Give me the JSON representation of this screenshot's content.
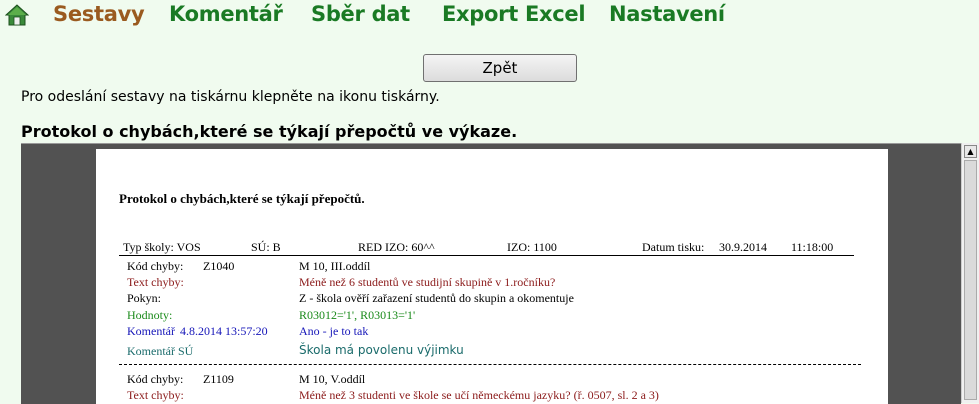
{
  "nav": {
    "home_icon": "home-icon",
    "items": [
      {
        "label": "Sestavy",
        "active": true
      },
      {
        "label": "Komentář",
        "active": false
      },
      {
        "label": "Sběr dat",
        "active": false
      },
      {
        "label": "Export Excel",
        "active": false
      },
      {
        "label": "Nastavení",
        "active": false
      }
    ]
  },
  "back_button": "Zpět",
  "instruction": "Pro odeslání sestavy na tiskárnu klepněte na ikonu tiskárny.",
  "heading": "Protokol o chybách,které se týkají přepočtů ve výkaze.",
  "report": {
    "title": "Protokol o chybách,které se týkají přepočtů.",
    "header": {
      "typ_skoly": "Typ školy: VOS",
      "su": "SÚ: B",
      "red_izo": "RED  IZO: 60^^",
      "izo": "IZO: 1100",
      "datum_label": "Datum tisku:",
      "datum": "30.9.2014",
      "time": "11:18:00"
    },
    "errors": [
      {
        "kod_label": "Kód chyby:",
        "kod": "Z1040",
        "section": "M 10, III.oddíl",
        "text_label": "Text chyby:",
        "text": "Méně než 6 studentů ve studijní skupině v 1.ročníku?",
        "pokyn_label": "Pokyn:",
        "pokyn": "Z - škola ověří zařazení studentů do skupin a okomentuje",
        "hodnoty_label": "Hodnoty:",
        "hodnoty": "R03012='1', R03013='1'",
        "komentar_label": "Komentář",
        "komentar_date": "4.8.2014  13:57:20",
        "komentar": "Ano - je to tak",
        "komentar_su_label": "Komentář SÚ",
        "komentar_su": "Škola má povolenu výjimku"
      },
      {
        "kod_label": "Kód chyby:",
        "kod": "Z1109",
        "section": "M 10, V.oddíl",
        "text_label": "Text chyby:",
        "text": "Méně než 3 studenti ve škole se učí německému jazyku? (ř. 0507, sl. 2 a 3)"
      }
    ]
  },
  "colors": {
    "nav": "#1a7a24",
    "nav_active": "#9a5a1f",
    "background": "#f0fbef",
    "viewer_bg": "#525252"
  }
}
